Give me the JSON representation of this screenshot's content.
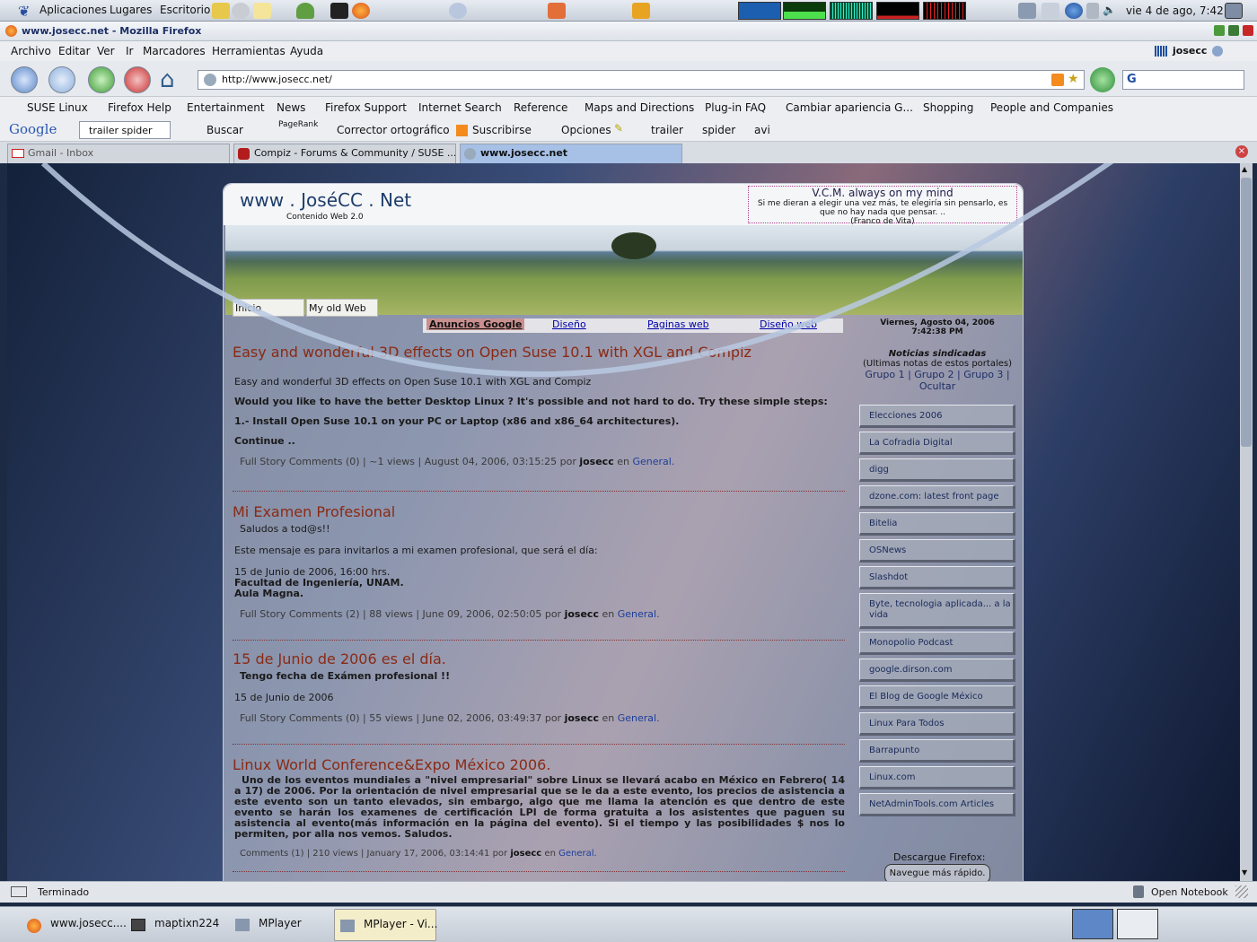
{
  "top_panel": {
    "menus": [
      "Aplicaciones",
      "Lugares",
      "Escritorio"
    ],
    "clock": "vie 4 de ago, 7:42"
  },
  "window": {
    "title": "www.josecc.net - Mozilla Firefox"
  },
  "menubar": [
    "Archivo",
    "Editar",
    "Ver",
    "Ir",
    "Marcadores",
    "Herramientas",
    "Ayuda"
  ],
  "user": "josecc",
  "url": "http://www.josecc.net/",
  "bookmarks": [
    "SUSE Linux",
    "Firefox Help",
    "Entertainment",
    "News",
    "Firefox Support",
    "Internet Search",
    "Reference",
    "Maps and Directions",
    "Plug-in FAQ",
    "Cambiar apariencia G...",
    "Shopping",
    "People and Companies"
  ],
  "google_toolbar": {
    "logo": "Google",
    "query": "trailer spider",
    "buscar": "Buscar",
    "pagerank": "PageRank",
    "corrector": "Corrector ortográfico",
    "suscribirse": "Suscribirse",
    "opciones": "Opciones",
    "highlights": [
      "trailer",
      "spider",
      "avi"
    ]
  },
  "tabs": [
    "Gmail - Inbox",
    "Compiz - Forums & Community / SUSE ...",
    "www.josecc.net"
  ],
  "status": "Terminado",
  "open_notebook": "Open Notebook",
  "taskbar": [
    "www.josecc....",
    "maptixn224",
    "MPlayer",
    "MPlayer - Vi..."
  ],
  "site": {
    "title": "www . JoséCC . Net",
    "subtitle": "Contenido Web 2.0",
    "quote_title": "V.C.M. always on my mind",
    "quote_text": "Si me dieran a elegir una vez más, te elegiría sin pensarlo, es que no hay nada que pensar. ..",
    "quote_author": "(Franco de Vita)",
    "nav_tabs": [
      "Inicio",
      "My old Web"
    ],
    "ad_links": [
      "Anuncios Google",
      "Diseño",
      "Paginas web",
      "Diseño web"
    ],
    "date": "Viernes, Agosto 04, 2006",
    "time": "7:42:38 PM",
    "syndicated_title": "Noticias sindicadas",
    "syndicated_sub": "(Ultimas notas de estos portales)",
    "groups": "Grupo 1 | Grupo 2 | Grupo 3 | Ocultar",
    "sidebar_links": [
      "Elecciones 2006",
      "La Cofradia Digital",
      "digg",
      "dzone.com: latest front page",
      "Bitelia",
      "OSNews",
      "Slashdot",
      "Byte, tecnologia aplicada... a la vida",
      "Monopolio Podcast",
      "google.dirson.com",
      "El Blog de Google México",
      "Linux Para Todos",
      "Barrapunto",
      "Linux.com",
      "NetAdminTools.com Articles"
    ],
    "firefox_title": "Descargue Firefox:",
    "firefox_button": "Navegue más rápido.",
    "posts": [
      {
        "title": "Easy and wonderful 3D effects on Open Suse 10.1 with XGL and Compiz",
        "lines": [
          "Easy and wonderful 3D effects on Open Suse 10.1 with XGL and Compiz",
          "Would you like to have the better Desktop Linux ? It's possible and not hard to do. Try these simple steps:",
          "1.- Install Open Suse 10.1 on your PC or Laptop (x86 and x86_64 architectures).",
          "Continue .."
        ],
        "meta": "Full Story Comments (0) | ~1 views | August 04, 2006, 03:15:25 por",
        "author": "josecc",
        "en": "en",
        "category": "General."
      },
      {
        "title": "Mi Examen Profesional",
        "lines": [
          "Saludos a tod@s!!",
          "Este mensaje es para invitarlos a mi examen profesional, que será el día:",
          "15 de Junio de 2006, 16:00 hrs.",
          "Facultad de Ingeniería, UNAM.",
          "Aula Magna."
        ],
        "meta": "Full Story Comments (2) | 88 views | June 09, 2006, 02:50:05 por",
        "author": "josecc",
        "en": "en",
        "category": "General."
      },
      {
        "title": "15 de Junio de 2006 es el día.",
        "lines": [
          "Tengo fecha de Exámen profesional !!",
          "15 de Junio de 2006"
        ],
        "meta": "Full Story Comments (0) | 55 views | June 02, 2006, 03:49:37 por",
        "author": "josecc",
        "en": "en",
        "category": "General."
      },
      {
        "title": "Linux World Conference&Expo México 2006.",
        "lines": [
          "Uno de los eventos mundiales a \"nivel empresarial\" sobre Linux se llevará acabo en México en Febrero( 14 a 17) de 2006. Por la orientación de nivel empresarial que se le da a este evento, los precios de asistencia a este evento son un tanto elevados, sin embargo, algo que me llama la atención es que dentro de este evento se harán los examenes de certificación LPI de forma gratuita a los asistentes que paguen su asistencia al evento(más información en la página del evento). Si el tiempo y las posibilidades $ nos lo permiten, por alla nos vemos. Saludos."
        ],
        "meta": "Comments (1) | 210 views | January 17, 2006, 03:14:41 por",
        "author": "josecc",
        "en": "en",
        "category": "General."
      }
    ]
  }
}
